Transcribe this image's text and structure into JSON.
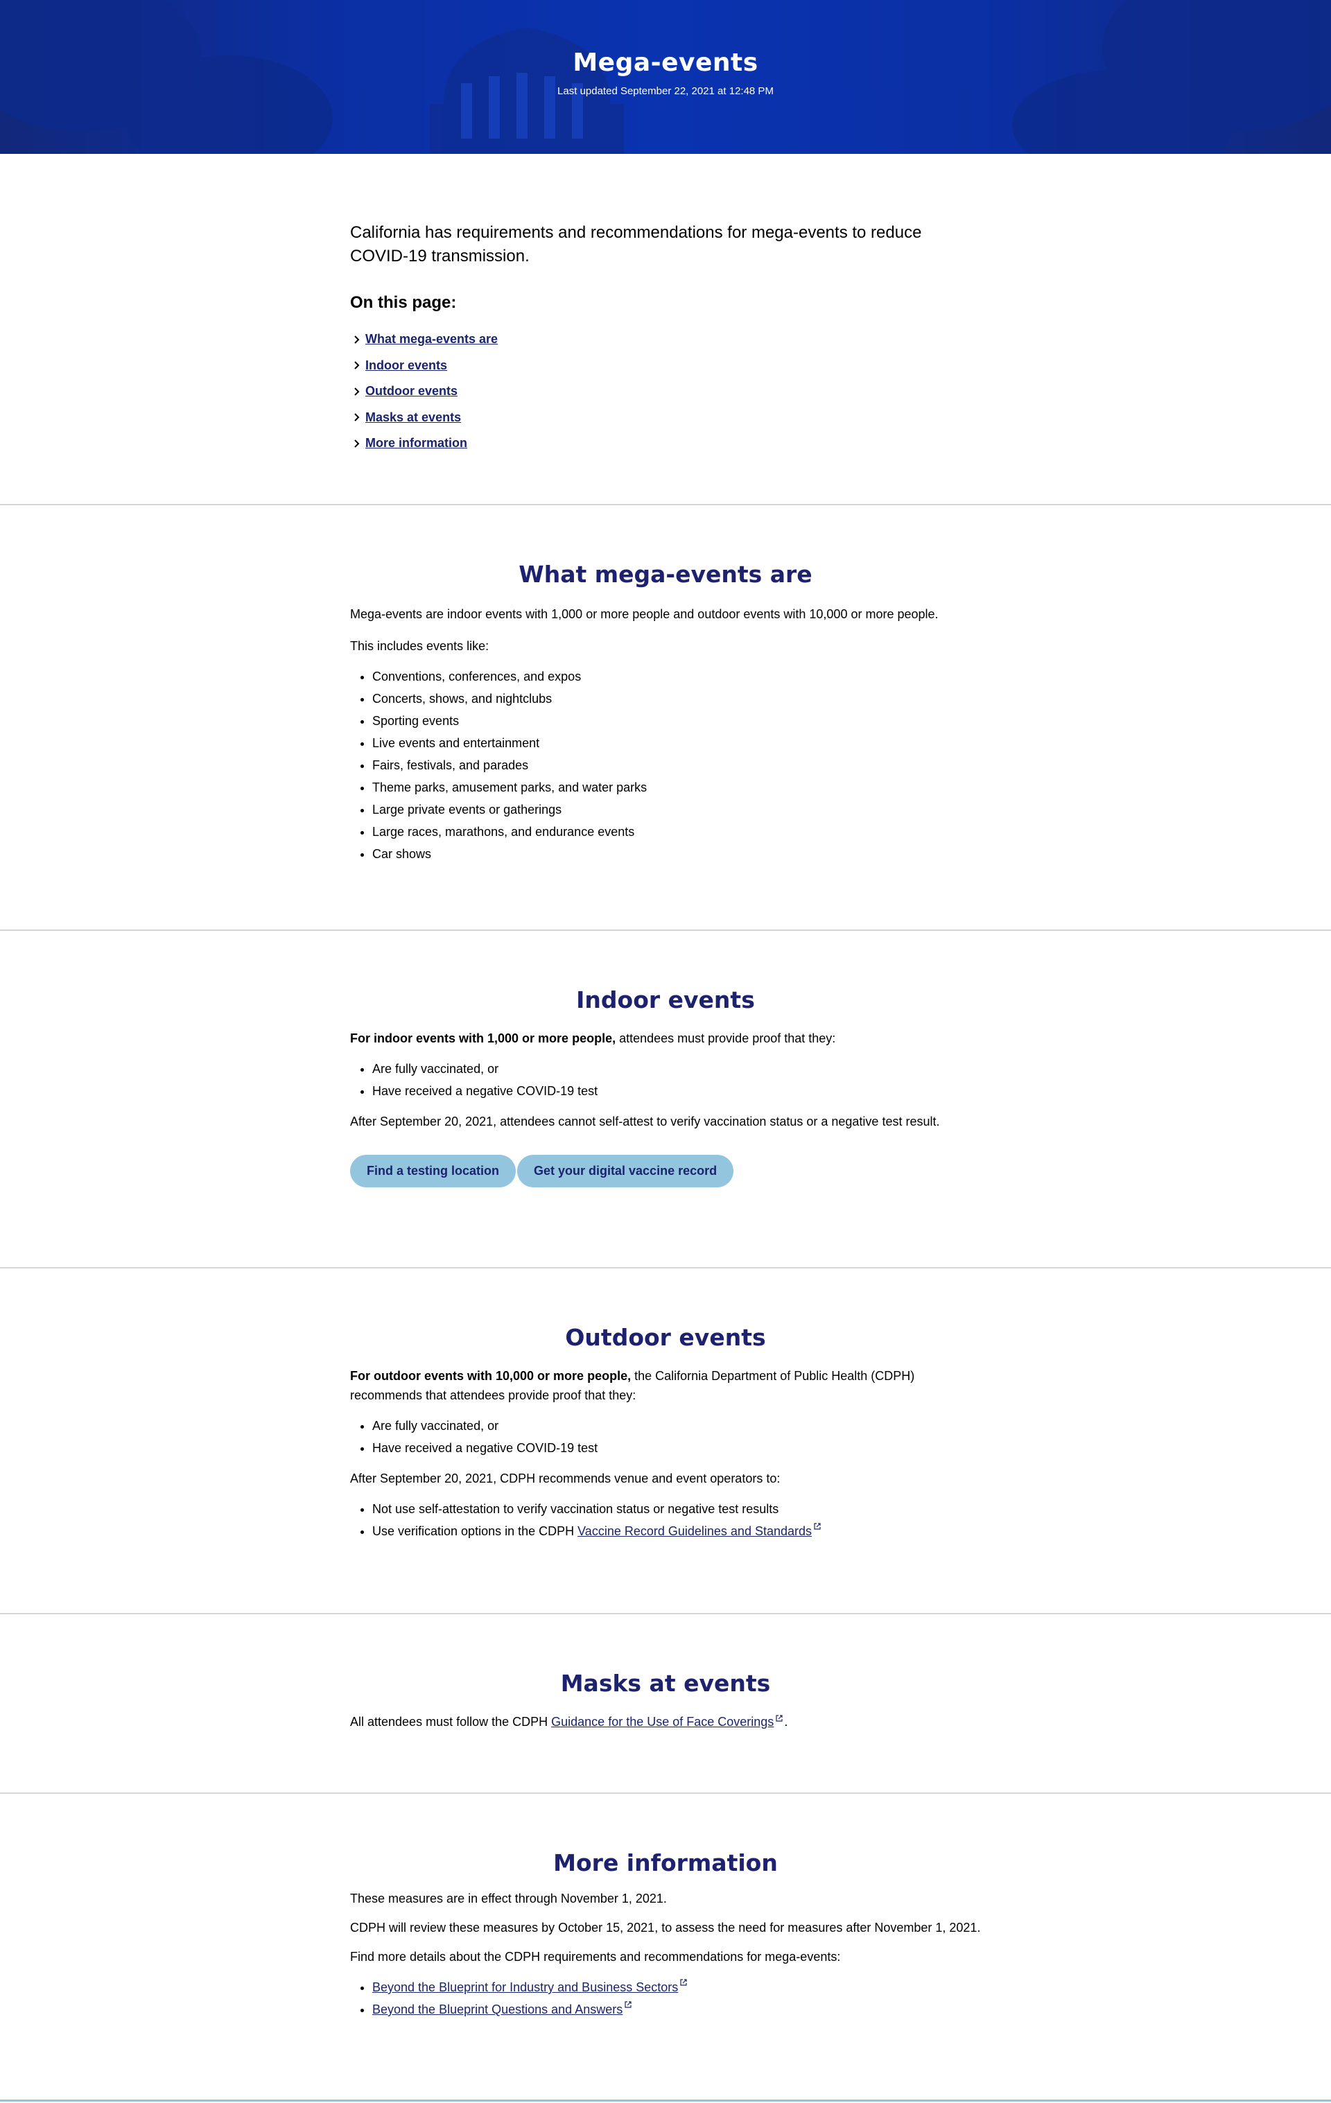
{
  "header": {
    "title": "Mega-events",
    "last_updated": "Last updated September 22, 2021 at 12:48 PM"
  },
  "intro": {
    "lead": "California has requirements and recommendations for mega-events to reduce COVID-19 transmission.",
    "toc_title": "On this page:",
    "toc": [
      "What mega-events are",
      "Indoor events",
      "Outdoor events",
      "Masks at events",
      "More information"
    ]
  },
  "what": {
    "title": "What mega-events are",
    "p1": "Mega-events are indoor events with 1,000 or more people and outdoor events with 10,000 or more people.",
    "p2": "This includes events like:",
    "items": [
      "Conventions, conferences, and expos",
      "Concerts, shows, and nightclubs",
      "Sporting events",
      "Live events and entertainment",
      "Fairs, festivals, and parades",
      "Theme parks, amusement parks, and water parks",
      "Large private events or gatherings",
      "Large races, marathons, and endurance events",
      "Car shows"
    ]
  },
  "indoor": {
    "title": "Indoor events",
    "p1_bold": "For indoor events with 1,000 or more people,",
    "p1_rest": " attendees must provide proof that they:",
    "items": [
      "Are fully vaccinated, or",
      "Have received a negative COVID-19 test"
    ],
    "p2": "After September 20, 2021, attendees cannot self-attest to verify vaccination status or a negative test result.",
    "btn1": "Find a testing location",
    "btn2": "Get your digital vaccine record"
  },
  "outdoor": {
    "title": "Outdoor events",
    "p1_bold": "For outdoor events with 10,000 or more people,",
    "p1_rest": " the California Department of Public Health (CDPH) recommends that attendees provide proof that they:",
    "items": [
      "Are fully vaccinated, or",
      "Have received a negative COVID-19 test"
    ],
    "p2": "After September 20, 2021, CDPH recommends venue and event operators to:",
    "items2_0": "Not use self-attestation to verify vaccination status or negative test results",
    "items2_1_prefix": "Use verification options in the CDPH ",
    "items2_1_link": "Vaccine Record Guidelines and Standards"
  },
  "masks": {
    "title": "Masks at events",
    "p_prefix": "All attendees must follow the CDPH ",
    "p_link": "Guidance for the Use of Face Coverings",
    "p_suffix": "."
  },
  "more": {
    "title": "More information",
    "p1": "These measures are in effect through November 1, 2021.",
    "p2": "CDPH will review these measures by October 15, 2021, to assess the need for measures after November 1, 2021.",
    "p3": "Find more details about the CDPH requirements and recommendations for mega-events:",
    "links": [
      "Beyond the Blueprint for Industry and Business Sectors",
      "Beyond the Blueprint Questions and Answers"
    ]
  },
  "colors": {
    "hero_blue": "#0a33b0",
    "heading_navy": "#1e226e",
    "link_navy": "#1a246e",
    "button_bg": "#94c5df"
  },
  "icons": {
    "toc": "chevron-right-icon",
    "external": "external-link-icon"
  }
}
